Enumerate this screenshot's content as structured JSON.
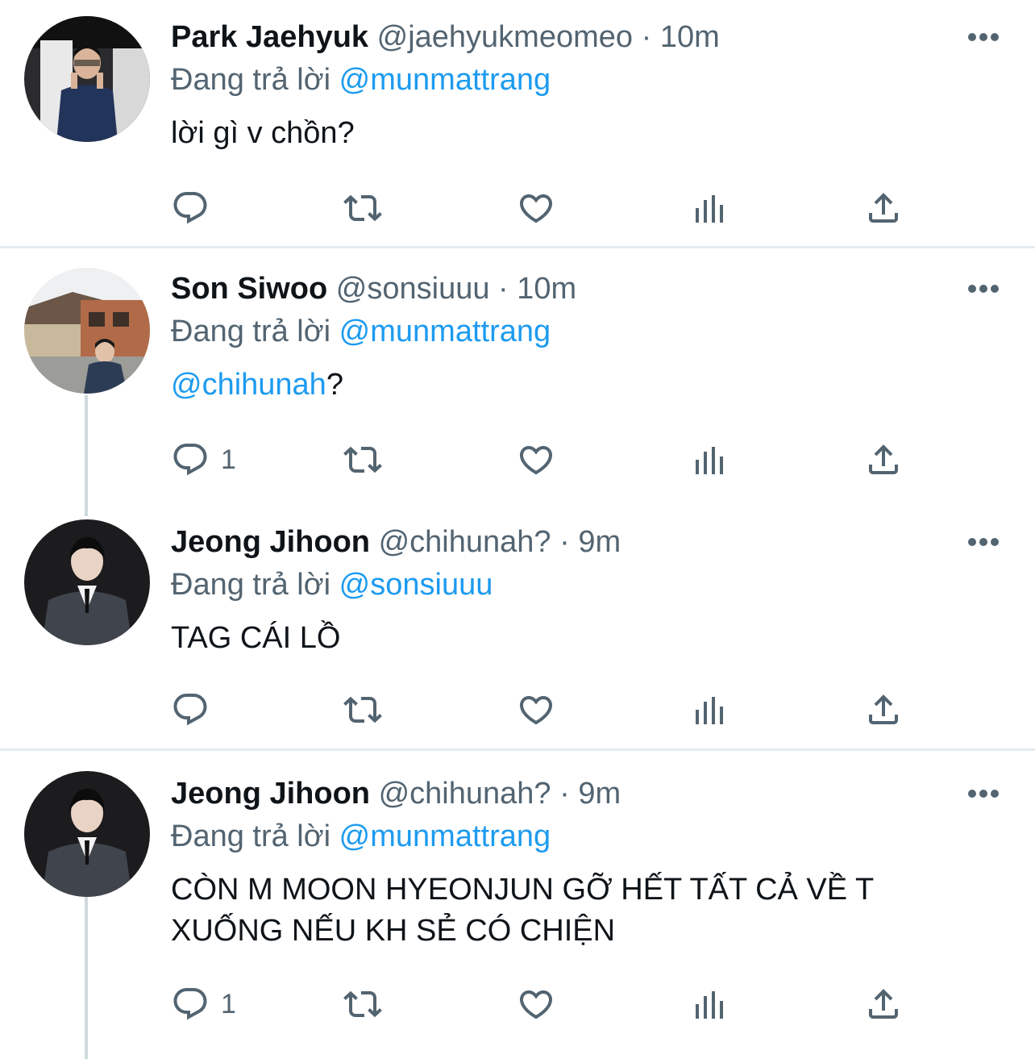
{
  "tweets": [
    {
      "name": "Park Jaehyuk",
      "handle": "@jaehyukmeomeo",
      "time": "10m",
      "reply_prefix": "Đang trả lời",
      "reply_to": "@munmattrang",
      "text": "lời gì v chồn?",
      "reply_count": ""
    },
    {
      "name": "Son Siwoo",
      "handle": "@sonsiuuu",
      "time": "10m",
      "reply_prefix": "Đang trả lời",
      "reply_to": "@munmattrang",
      "text_mention": "@chihunah",
      "text_rest": "?",
      "reply_count": "1"
    },
    {
      "name": "Jeong Jihoon",
      "handle": "@chihunah?",
      "time": "9m",
      "reply_prefix": "Đang trả lời",
      "reply_to": "@sonsiuuu",
      "text": "TAG CÁI LỒ",
      "reply_count": ""
    },
    {
      "name": "Jeong Jihoon",
      "handle": "@chihunah?",
      "time": "9m",
      "reply_prefix": "Đang trả lời",
      "reply_to": "@munmattrang",
      "text_line1": "CÒN M MOON HYEONJUN GỠ HẾT TẤT CẢ VỀ T",
      "text_line2": "XUỐNG NẾU KH SẺ CÓ CHIỆN",
      "reply_count": "1"
    }
  ],
  "separator": " · ",
  "icons": [
    "reply-icon",
    "retweet-icon",
    "like-icon",
    "analytics-icon",
    "share-icon",
    "more-icon"
  ],
  "colors": {
    "mention": "#1d9bf0",
    "muted": "#536471",
    "text": "#0f1419"
  }
}
